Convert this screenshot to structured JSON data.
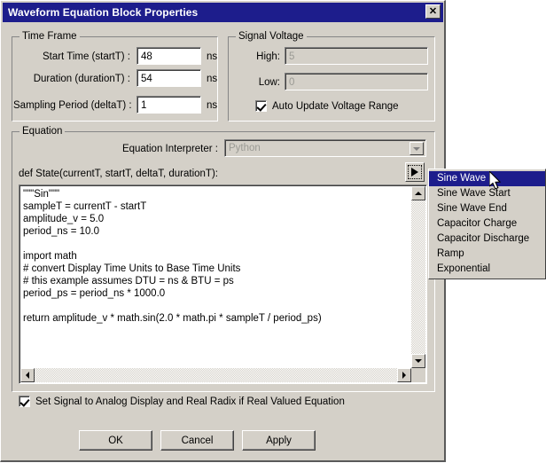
{
  "window": {
    "title": "Waveform Equation Block Properties",
    "close_label": "✕",
    "titlebar_color": "#1d1d8c",
    "face_color": "#d4d0c8"
  },
  "time_frame": {
    "legend": "Time Frame",
    "rows": [
      {
        "label": "Start Time (startT) :",
        "value": "48",
        "unit": "ns"
      },
      {
        "label": "Duration (durationT) :",
        "value": "54",
        "unit": "ns"
      },
      {
        "label": "Sampling Period (deltaT) :",
        "value": "1",
        "unit": "ns"
      }
    ]
  },
  "signal_voltage": {
    "legend": "Signal Voltage",
    "high_label": "High:",
    "high_value": "5",
    "low_label": "Low:",
    "low_value": "0",
    "auto_update_label": "Auto Update Voltage Range",
    "auto_update_checked": true
  },
  "equation": {
    "legend": "Equation",
    "interpreter_label": "Equation Interpreter :",
    "interpreter_value": "Python",
    "signature": "def State(currentT, startT, deltaT, durationT):",
    "example_button_icon": "play-triangle-icon",
    "code": "\"\"\"Sin\"\"\"\nsampleT = currentT - startT\namplitude_v = 5.0\nperiod_ns = 10.0\n\nimport math\n# convert Display Time Units to Base Time Units\n# this example assumes DTU = ns & BTU = ps\nperiod_ps = period_ns * 1000.0\n\nreturn amplitude_v * math.sin(2.0 * math.pi * sampleT / period_ps)"
  },
  "analog_option": {
    "label": "Set Signal to Analog Display and Real Radix if Real Valued Equation",
    "checked": true
  },
  "buttons": {
    "ok": "OK",
    "cancel": "Cancel",
    "apply": "Apply"
  },
  "example_menu": {
    "selected_index": 0,
    "highlight_color": "#1d1d8c",
    "items": [
      {
        "label": "Sine Wave"
      },
      {
        "label": "Sine Wave Start"
      },
      {
        "label": "Sine Wave End"
      },
      {
        "label": "Capacitor Charge"
      },
      {
        "label": "Capacitor Discharge"
      },
      {
        "label": "Ramp"
      },
      {
        "label": "Exponential"
      }
    ]
  }
}
